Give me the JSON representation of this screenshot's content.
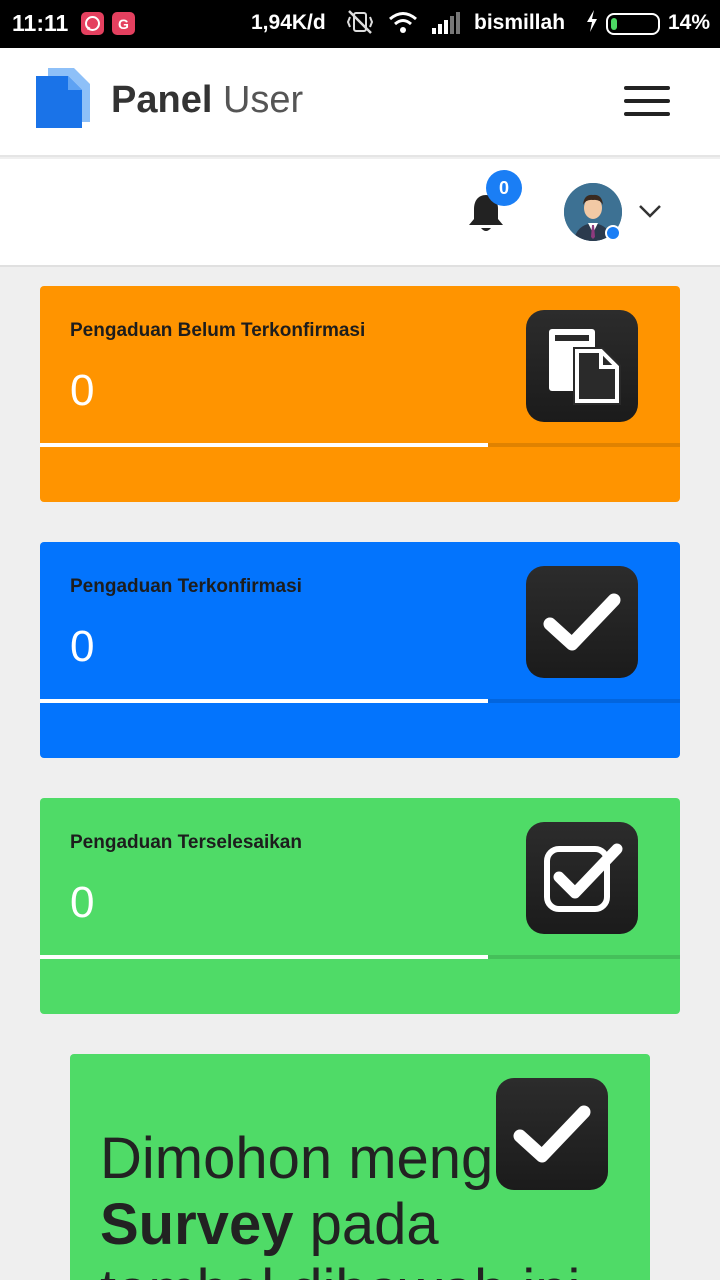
{
  "status_bar": {
    "time": "11:11",
    "net_speed": "1,94K/d",
    "carrier": "bismillah",
    "battery_percent": "14%",
    "battery_level": 0.14,
    "notification_icons": [
      "whatsapp-icon",
      "google-icon"
    ]
  },
  "header": {
    "brand_bold": "Panel",
    "brand_light": "User",
    "logo_color": "#1a73e8"
  },
  "userbar": {
    "notification_count": "0"
  },
  "cards": [
    {
      "title": "Pengaduan Belum Terkonfirmasi",
      "value": "0",
      "progress": 0.7,
      "color": "#ff9400",
      "icon": "documents-icon"
    },
    {
      "title": "Pengaduan Terkonfirmasi",
      "value": "0",
      "progress": 0.7,
      "color": "#0374fd",
      "icon": "checkmark-icon"
    },
    {
      "title": "Pengaduan Terselesaikan",
      "value": "0",
      "progress": 0.7,
      "color": "#4fdb67",
      "icon": "checkbox-checked-icon"
    }
  ],
  "survey": {
    "line1": "Dimohon mengisi",
    "line2_strong": "Survey",
    "line2_rest": " pada",
    "line3": "tombol dibawah ini",
    "color": "#4fdb67"
  }
}
